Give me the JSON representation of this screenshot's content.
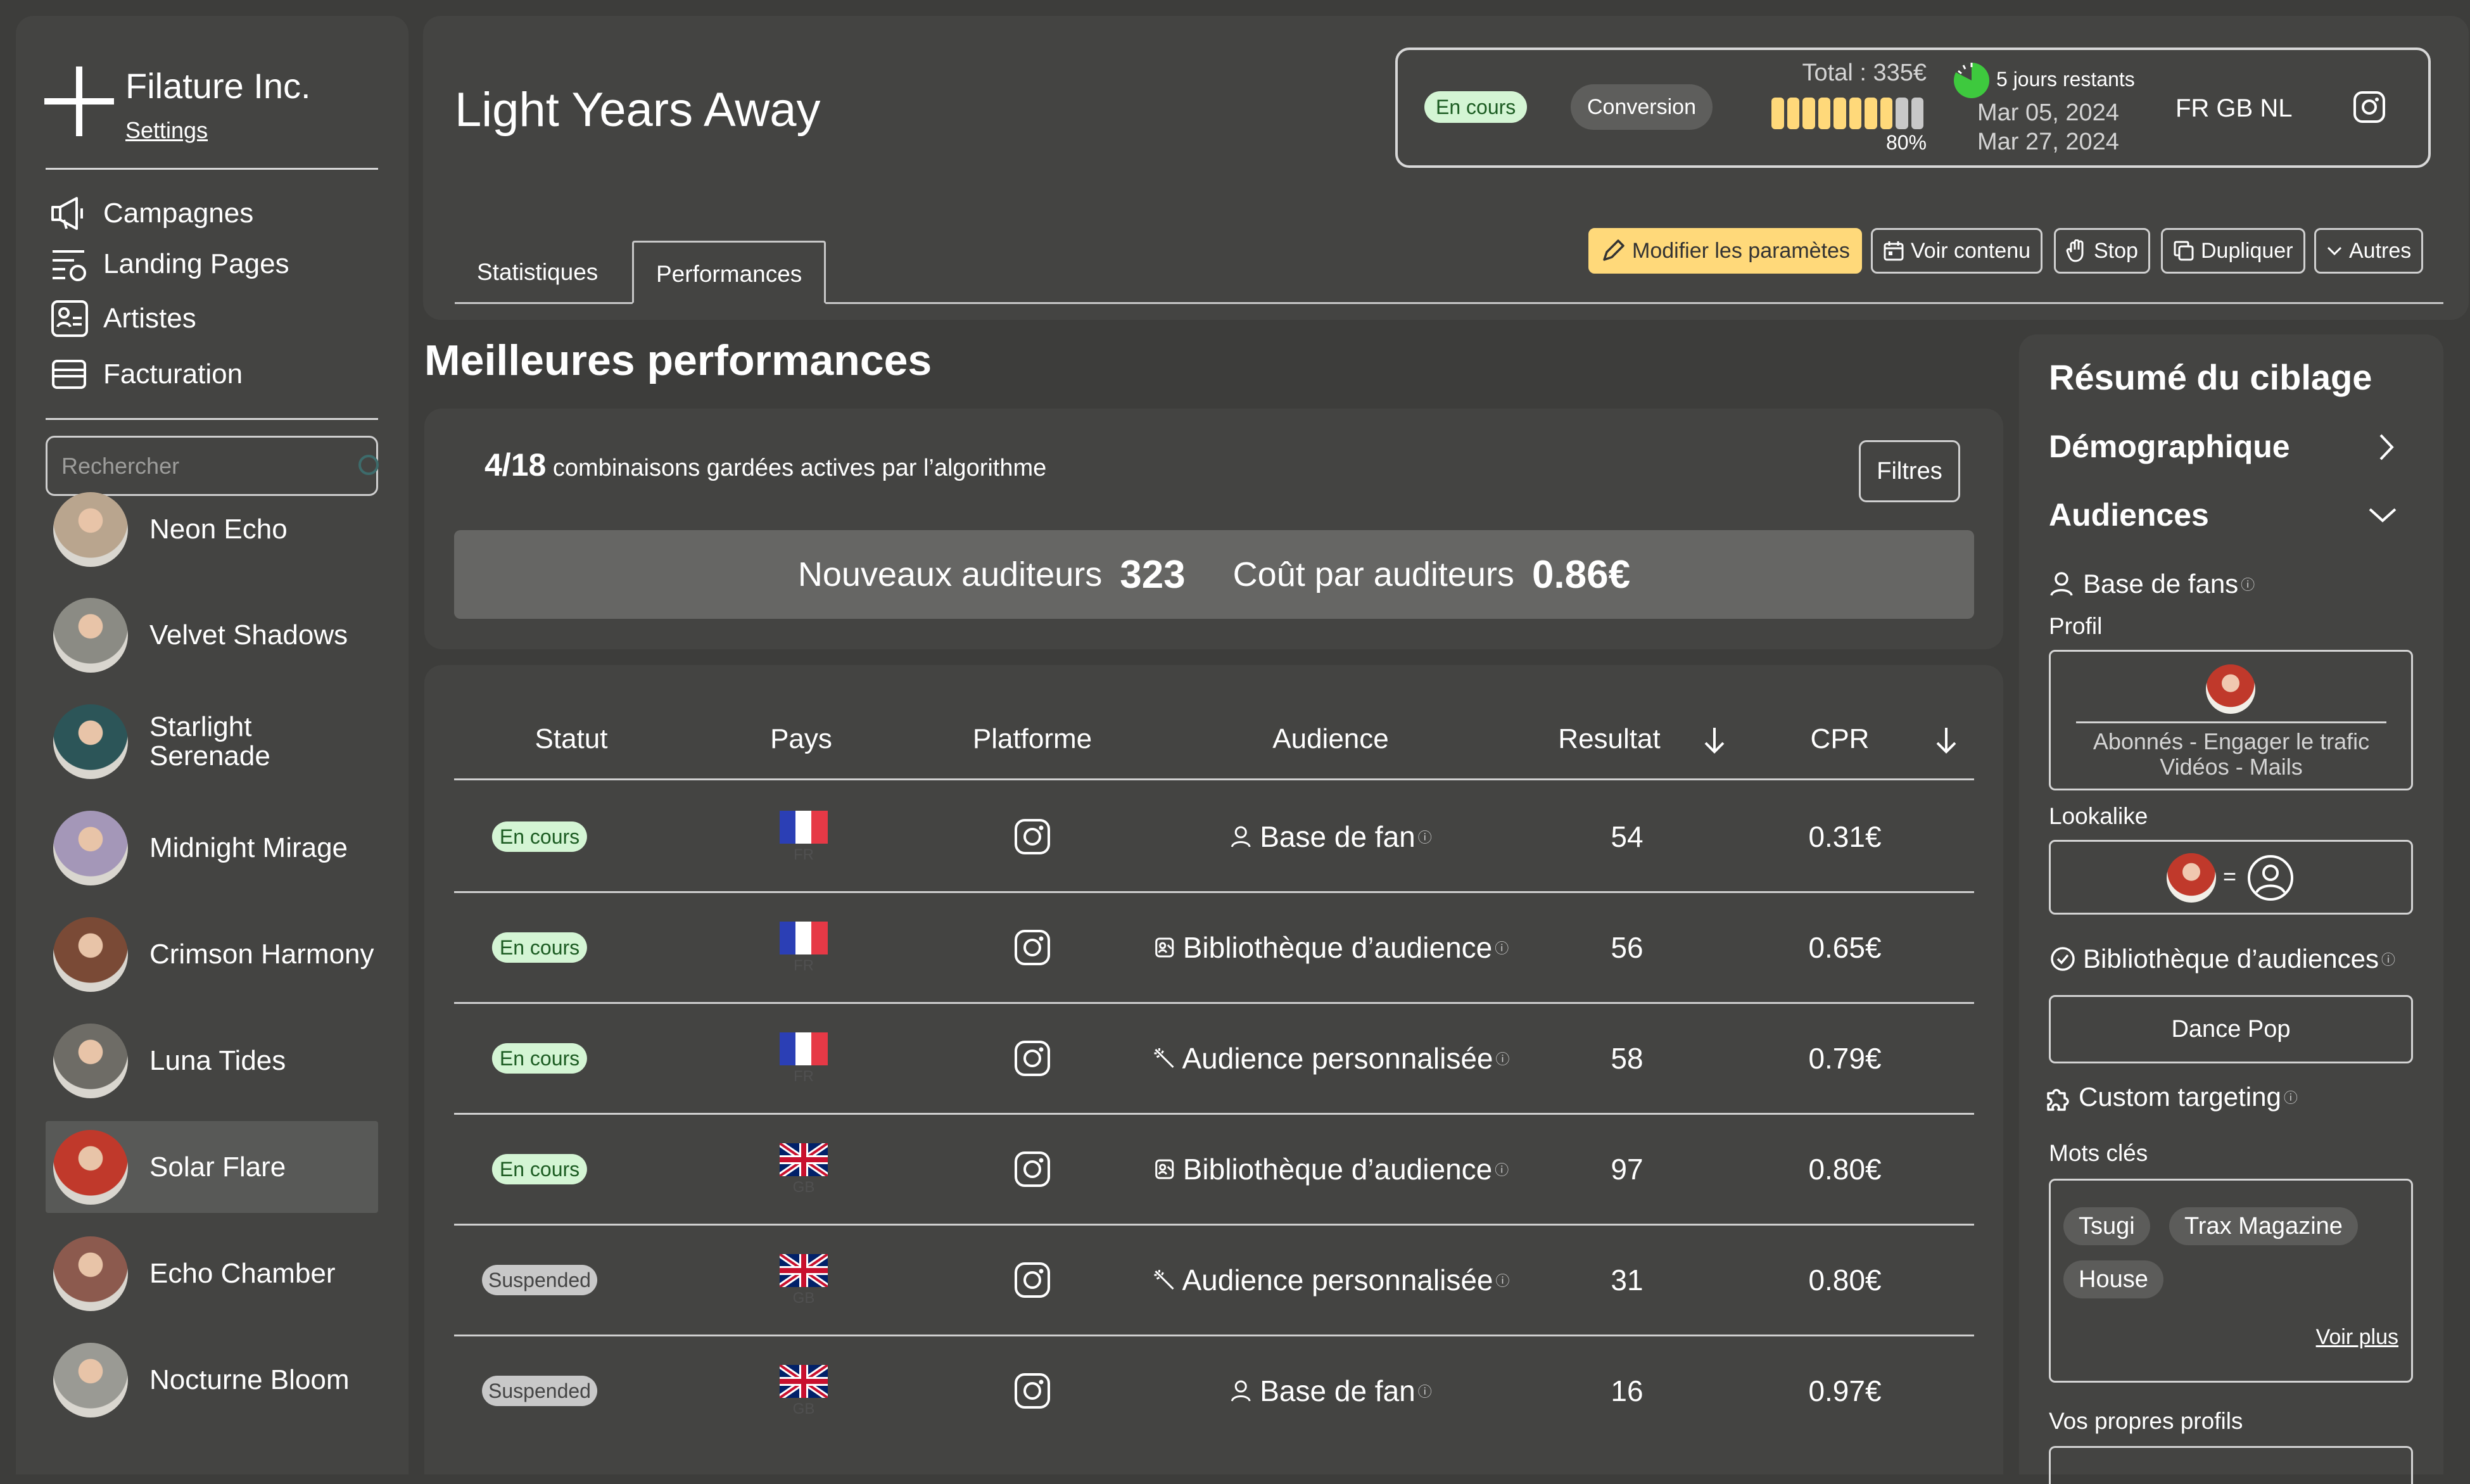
{
  "brand": {
    "name": "Filature Inc.",
    "settings_link": "Settings"
  },
  "nav": [
    {
      "label": "Campagnes",
      "icon": "megaphone-icon"
    },
    {
      "label": "Landing Pages",
      "icon": "landing-icon"
    },
    {
      "label": "Artistes",
      "icon": "artists-icon"
    },
    {
      "label": "Facturation",
      "icon": "billing-icon"
    }
  ],
  "search": {
    "placeholder": "Rechercher"
  },
  "artists": [
    {
      "name": "Neon Echo",
      "color": "#b9a58e"
    },
    {
      "name": "Velvet Shadows",
      "color": "#8b8b84"
    },
    {
      "name": "Starlight Serenade",
      "color": "#2c5558"
    },
    {
      "name": "Midnight Mirage",
      "color": "#a497b8"
    },
    {
      "name": "Crimson Harmony",
      "color": "#7a4a36"
    },
    {
      "name": "Luna Tides",
      "color": "#6e6c66"
    },
    {
      "name": "Solar Flare",
      "color": "#c0392b",
      "active": true
    },
    {
      "name": "Echo Chamber",
      "color": "#8c5a4e"
    },
    {
      "name": "Nocturne Bloom",
      "color": "#9a9a94"
    }
  ],
  "campaign": {
    "title": "Light Years Away",
    "status": "En cours",
    "objective": "Conversion",
    "total": "Total : 335€",
    "budget_percent_label": "80%",
    "budget_percent": 80,
    "days_left": "5 jours restants",
    "start_date": "Mar 05, 2024",
    "end_date": "Mar 27, 2024",
    "countries": "FR GB NL"
  },
  "tabs": [
    "Statistiques",
    "Performances"
  ],
  "actions": {
    "edit": "Modifier les paramètes",
    "view": "Voir contenu",
    "stop": "Stop",
    "duplicate": "Dupliquer",
    "more": "Autres"
  },
  "performance": {
    "title": "Meilleures performances",
    "combos_count": "4/18",
    "combos_text": "combinaisons gardées actives par l’algorithme",
    "filters": "Filtres",
    "new_listeners_label": "Nouveaux auditeurs",
    "new_listeners_value": "323",
    "cost_label": "Coût par auditeurs",
    "cost_value": "0.86€"
  },
  "table": {
    "headers": {
      "status": "Statut",
      "country": "Pays",
      "platform": "Platforme",
      "audience": "Audience",
      "result": "Resultat",
      "cpr": "CPR"
    },
    "rows": [
      {
        "status": "En cours",
        "status_type": "green",
        "flag": "fr",
        "flag_code": "FR",
        "audience": "Base de fan",
        "audience_icon": "user-icon",
        "result": "54",
        "cpr": "0.31€"
      },
      {
        "status": "En cours",
        "status_type": "green",
        "flag": "fr",
        "flag_code": "FR",
        "audience": "Bibliothèque d’audience",
        "audience_icon": "library-icon",
        "result": "56",
        "cpr": "0.65€"
      },
      {
        "status": "En cours",
        "status_type": "green",
        "flag": "fr",
        "flag_code": "FR",
        "audience": "Audience personnalisée",
        "audience_icon": "wand-icon",
        "result": "58",
        "cpr": "0.79€"
      },
      {
        "status": "En cours",
        "status_type": "green",
        "flag": "gb",
        "flag_code": "GB",
        "audience": "Bibliothèque d’audience",
        "audience_icon": "library-icon",
        "result": "97",
        "cpr": "0.80€"
      },
      {
        "status": "Suspended",
        "status_type": "grey",
        "flag": "gb",
        "flag_code": "GB",
        "audience": "Audience personnalisée",
        "audience_icon": "wand-icon",
        "result": "31",
        "cpr": "0.80€"
      },
      {
        "status": "Suspended",
        "status_type": "grey",
        "flag": "gb",
        "flag_code": "GB",
        "audience": "Base de fan",
        "audience_icon": "user-icon",
        "result": "16",
        "cpr": "0.97€"
      }
    ]
  },
  "targeting": {
    "title": "Résumé du ciblage",
    "demographic": "Démographique",
    "audiences": "Audiences",
    "fanbase": "Base de fans",
    "profile_label": "Profil",
    "profile_text": "Abonnés - Engager le trafic Vidéos - Mails",
    "lookalike_label": "Lookalike",
    "lookalike_eq": "=",
    "library": "Bibliothèque d’audiences",
    "library_value": "Dance Pop",
    "custom": "Custom targeting",
    "keywords_label": "Mots clés",
    "keywords": [
      "Tsugi",
      "Trax Magazine",
      "House"
    ],
    "see_more": "Voir plus",
    "own_profiles": "Vos propres profils"
  },
  "colors": {
    "bg": "#3d3d3b",
    "panel": "#444442",
    "accent_yellow": "#ffd97a",
    "status_green": "#d4f5d4",
    "progress_green": "#3ec93e"
  }
}
